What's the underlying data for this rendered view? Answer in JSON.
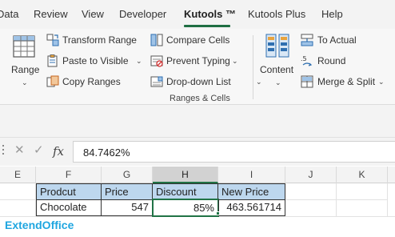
{
  "menu_tabs": [
    {
      "label": "Data"
    },
    {
      "label": "Review"
    },
    {
      "label": "View"
    },
    {
      "label": "Developer"
    },
    {
      "label": "Kutools ™",
      "active": true
    },
    {
      "label": "Kutools Plus"
    },
    {
      "label": "Help"
    }
  ],
  "ribbon": {
    "range": {
      "label": "Range"
    },
    "transform_range": "Transform Range",
    "paste_to_visible": "Paste to Visible",
    "copy_ranges": "Copy Ranges",
    "compare_cells": "Compare Cells",
    "prevent_typing": "Prevent Typing",
    "dropdown_list": "Drop-down List",
    "content": "Content",
    "to_actual": "To Actual",
    "round": "Round",
    "merge_split": "Merge & Split",
    "group_label": "Ranges & Cells",
    "accent_color": "#1f6e43"
  },
  "formula_bar": {
    "value": "84.7462%"
  },
  "grid": {
    "columns": [
      "E",
      "F",
      "G",
      "H",
      "I",
      "J",
      "K"
    ],
    "selected_column": "H",
    "header_row": [
      "Prodcut",
      "Price",
      "Discount",
      "New Price"
    ],
    "data_row": [
      "Chocolate",
      "547",
      "85%",
      "463.561714"
    ],
    "header_fill_color": "#bdd7ee",
    "selection_color": "#217346"
  },
  "watermark": "ExtendOffice"
}
